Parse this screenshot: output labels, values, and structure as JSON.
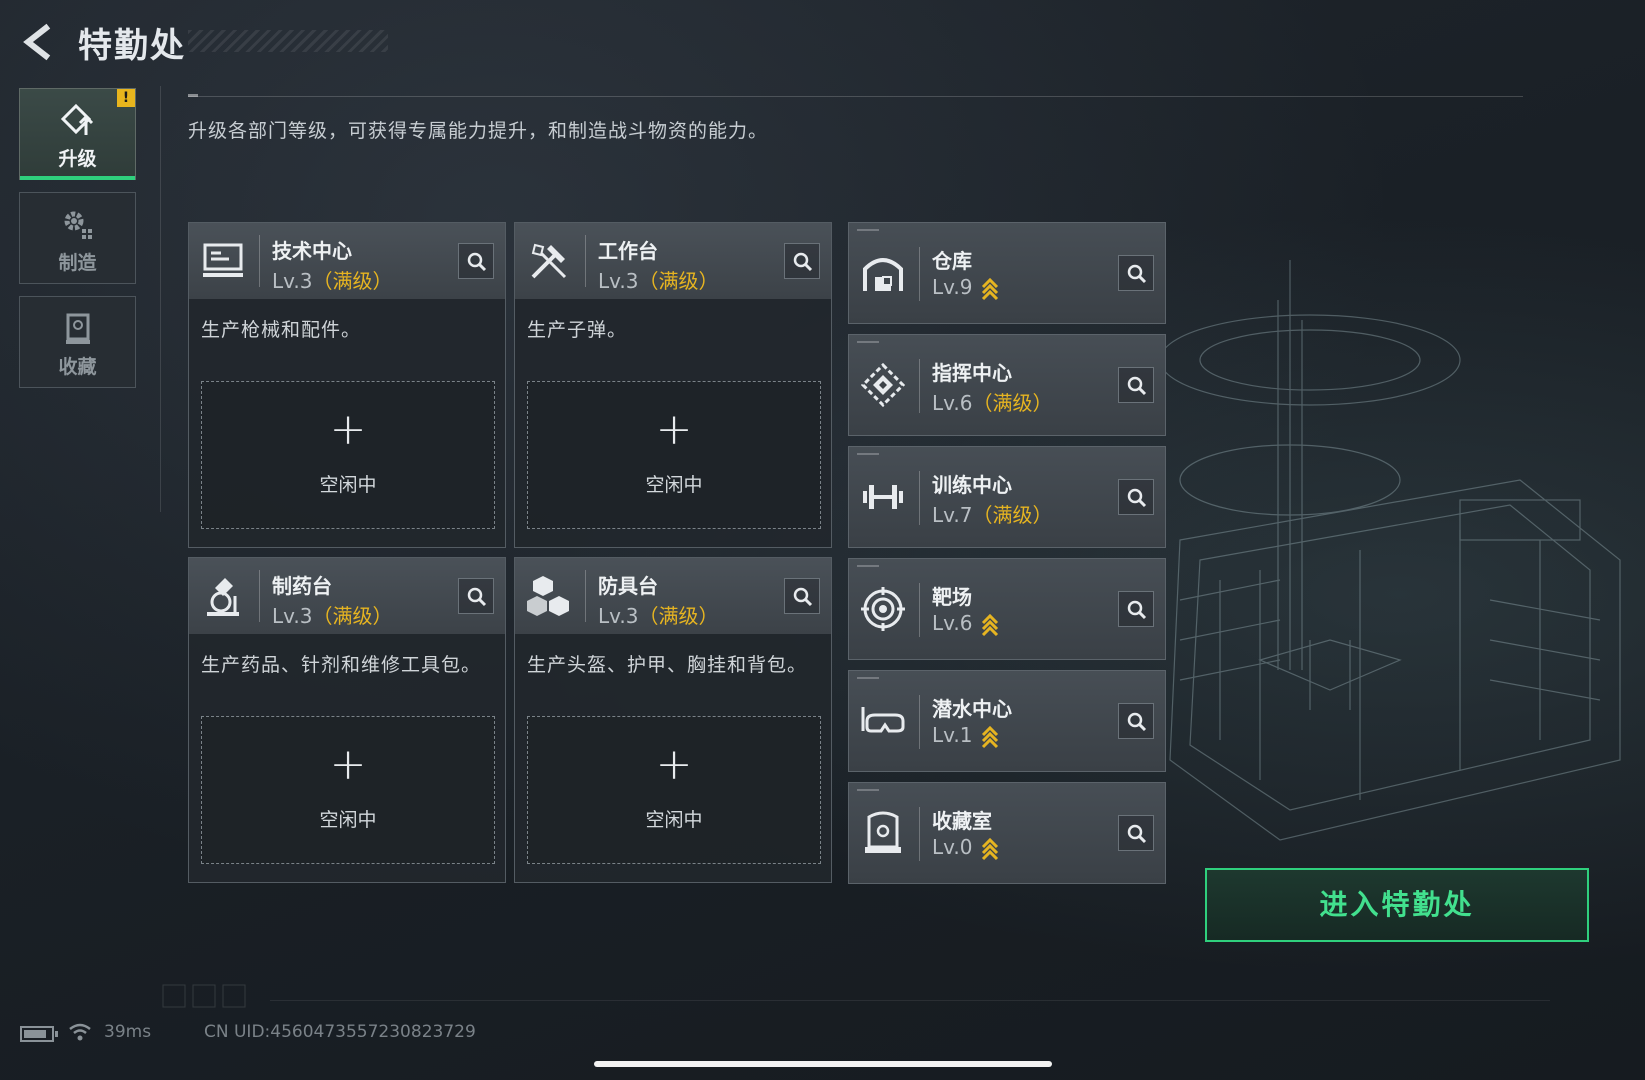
{
  "header": {
    "title": "特勤处"
  },
  "nav": {
    "items": [
      {
        "label": "升级",
        "active": true,
        "badge": "!"
      },
      {
        "label": "制造",
        "active": false
      },
      {
        "label": "收藏",
        "active": false
      }
    ]
  },
  "description": "升级各部门等级，可获得专属能力提升，和制造战斗物资的能力。",
  "production_cards": [
    {
      "name": "技术中心",
      "level": "Lv.3",
      "status": "（满级）",
      "desc": "生产枪械和配件。",
      "slot_label": "空闲中",
      "icon": "computer-icon"
    },
    {
      "name": "工作台",
      "level": "Lv.3",
      "status": "（满级）",
      "desc": "生产子弹。",
      "slot_label": "空闲中",
      "icon": "tools-icon"
    },
    {
      "name": "制药台",
      "level": "Lv.3",
      "status": "（满级）",
      "desc": "生产药品、针剂和维修工具包。",
      "slot_label": "空闲中",
      "icon": "microscope-icon"
    },
    {
      "name": "防具台",
      "level": "Lv.3",
      "status": "（满级）",
      "desc": "生产头盔、护甲、胸挂和背包。",
      "slot_label": "空闲中",
      "icon": "cubes-icon"
    }
  ],
  "departments": [
    {
      "name": "仓库",
      "level": "Lv.9",
      "status": "",
      "upgradable": true,
      "icon": "warehouse-icon"
    },
    {
      "name": "指挥中心",
      "level": "Lv.6",
      "status": "（满级）",
      "upgradable": false,
      "icon": "command-icon"
    },
    {
      "name": "训练中心",
      "level": "Lv.7",
      "status": "（满级）",
      "upgradable": false,
      "icon": "dumbbell-icon"
    },
    {
      "name": "靶场",
      "level": "Lv.6",
      "status": "",
      "upgradable": true,
      "icon": "target-icon"
    },
    {
      "name": "潜水中心",
      "level": "Lv.1",
      "status": "",
      "upgradable": true,
      "icon": "diving-mask-icon"
    },
    {
      "name": "收藏室",
      "level": "Lv.0",
      "status": "",
      "upgradable": true,
      "icon": "display-case-icon"
    }
  ],
  "enter_button": "进入特勤处",
  "status_bar": {
    "ping": "39ms",
    "uid": "CN UID:4560473557230823729"
  },
  "colors": {
    "accent": "#2fd07d",
    "max_level": "#e6b421",
    "badge": "#e8b51d"
  }
}
